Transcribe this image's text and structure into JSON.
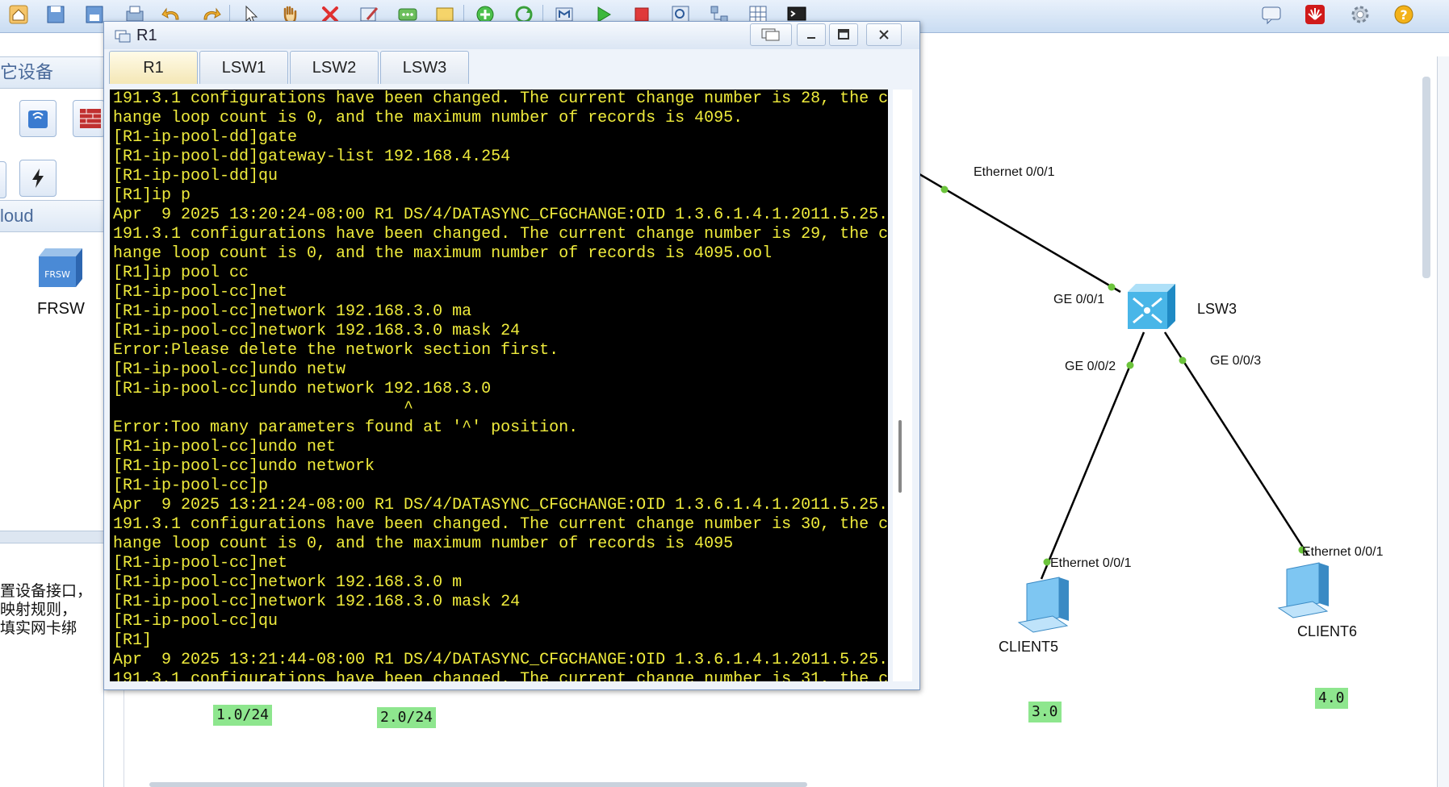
{
  "toolbar": {
    "icons": [
      "home-icon",
      "save-icon",
      "save-as-icon",
      "print-icon",
      "undo-icon",
      "redo-icon",
      "select-pointer-icon",
      "pan-hand-icon",
      "delete-icon",
      "draw-shape-icon",
      "text-note-icon",
      "rectangle-icon",
      "add-link-icon",
      "refresh-icon",
      "topology-icon",
      "start-device-icon",
      "stop-device-icon",
      "capture-icon",
      "layout-icon",
      "grid-icon",
      "terminal-icon"
    ],
    "right_icons": [
      "message-icon",
      "huawei-logo-icon",
      "settings-gear-icon",
      "help-icon"
    ]
  },
  "left_panel": {
    "section1_title": "它设备",
    "section2_title": "loud",
    "frsw_label": "FRSW",
    "help_text_lines": [
      "置设备接口，",
      "映射规则，",
      "填实网卡绑"
    ]
  },
  "terminal": {
    "title": "R1",
    "tabs": [
      "R1",
      "LSW1",
      "LSW2",
      "LSW3"
    ],
    "active_tab": "R1",
    "lines": [
      "191.3.1 configurations have been changed. The current change number is 28, the c",
      "hange loop count is 0, and the maximum number of records is 4095.",
      "[R1-ip-pool-dd]gate",
      "[R1-ip-pool-dd]gateway-list 192.168.4.254",
      "[R1-ip-pool-dd]qu",
      "[R1]ip p",
      "Apr  9 2025 13:20:24-08:00 R1 DS/4/DATASYNC_CFGCHANGE:OID 1.3.6.1.4.1.2011.5.25.",
      "191.3.1 configurations have been changed. The current change number is 29, the c",
      "hange loop count is 0, and the maximum number of records is 4095.ool",
      "[R1]ip pool cc",
      "[R1-ip-pool-cc]net",
      "[R1-ip-pool-cc]network 192.168.3.0 ma",
      "[R1-ip-pool-cc]network 192.168.3.0 mask 24",
      "Error:Please delete the network section first.",
      "[R1-ip-pool-cc]undo netw",
      "[R1-ip-pool-cc]undo network 192.168.3.0",
      "                              ^",
      "Error:Too many parameters found at '^' position.",
      "[R1-ip-pool-cc]undo net",
      "[R1-ip-pool-cc]undo network",
      "[R1-ip-pool-cc]p",
      "Apr  9 2025 13:21:24-08:00 R1 DS/4/DATASYNC_CFGCHANGE:OID 1.3.6.1.4.1.2011.5.25.",
      "191.3.1 configurations have been changed. The current change number is 30, the c",
      "hange loop count is 0, and the maximum number of records is 4095",
      "[R1-ip-pool-cc]net",
      "[R1-ip-pool-cc]network 192.168.3.0 m",
      "[R1-ip-pool-cc]network 192.168.3.0 mask 24",
      "[R1-ip-pool-cc]qu",
      "[R1]",
      "Apr  9 2025 13:21:44-08:00 R1 DS/4/DATASYNC_CFGCHANGE:OID 1.3.6.1.4.1.2011.5.25.",
      "191.3.1 configurations have been changed. The current change number is 31, the c"
    ]
  },
  "topology": {
    "ports": {
      "r1_eth": "Ethernet 0/0/1",
      "lsw3_ge1": "GE 0/0/1",
      "lsw3_ge2": "GE 0/0/2",
      "lsw3_ge3": "GE 0/0/3",
      "client5_eth": "Ethernet 0/0/1",
      "client6_eth": "Ethernet 0/0/1"
    },
    "devices": {
      "lsw3": "LSW3",
      "client5": "CLIENT5",
      "client6": "CLIENT6"
    },
    "subnets": [
      "1.0/24",
      "2.0/24",
      "3.0",
      "4.0"
    ],
    "colors": {
      "link": "#000000",
      "port_dot": "#6cc43c",
      "subnet_bg": "#8ee68e",
      "console_text": "#f0ec3c"
    }
  }
}
